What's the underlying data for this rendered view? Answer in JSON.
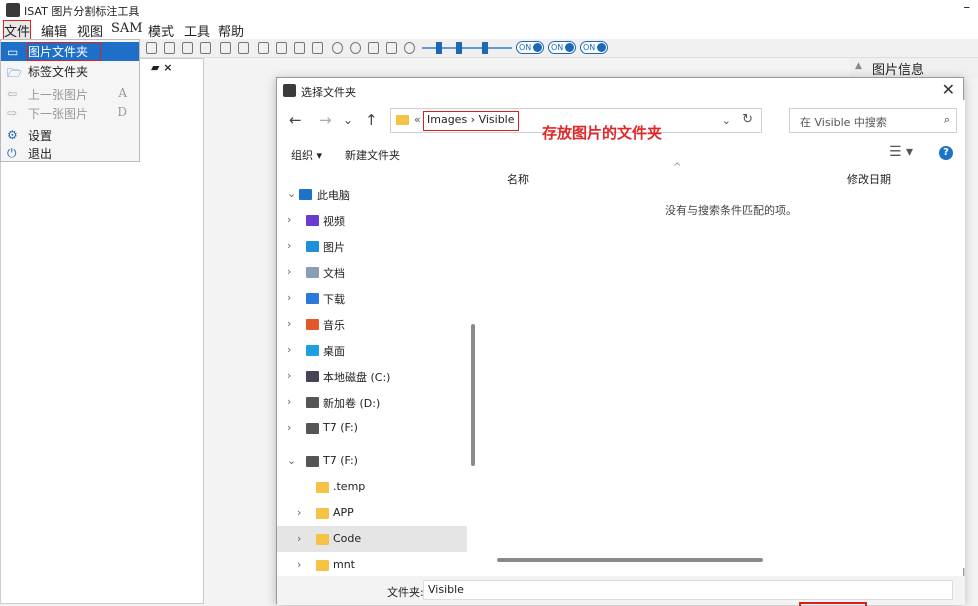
{
  "window": {
    "title": "ISAT 图片分割标注工具",
    "minimize": "–"
  },
  "menubar": [
    "文件",
    "编辑",
    "视图",
    "SAM",
    "模式",
    "工具",
    "帮助"
  ],
  "file_menu": [
    {
      "icon": "▭",
      "label": "图片文件夹",
      "shortcut": ""
    },
    {
      "icon": "🗁",
      "label": "标签文件夹",
      "shortcut": ""
    },
    {
      "icon": "⇦",
      "label": "上一张图片",
      "shortcut": "A"
    },
    {
      "icon": "⇨",
      "label": "下一张图片",
      "shortcut": "D"
    },
    {
      "icon": "⚙",
      "label": "设置",
      "shortcut": ""
    },
    {
      "icon": "⏻",
      "label": "退出",
      "shortcut": ""
    }
  ],
  "toolbar": {
    "toggles": [
      "ON",
      "ON",
      "ON"
    ]
  },
  "left_panel": {
    "header_icons": "▰ ×"
  },
  "right_panel": {
    "title": "图片信息",
    "arrow": "▲"
  },
  "dialog": {
    "title": "选择文件夹",
    "close": "✕",
    "nav": {
      "back": "←",
      "forward": "→",
      "recent": "⌄",
      "up": "↑"
    },
    "address": {
      "sep": "«",
      "path": "Images › Visible",
      "dropdown": "⌄",
      "refresh": "↻"
    },
    "search_placeholder": "在 Visible 中搜索",
    "annotation": "存放图片的文件夹",
    "commands": {
      "organize": "组织 ▾",
      "new_folder": "新建文件夹",
      "view": "☰ ▾",
      "help": "?"
    },
    "tree": [
      {
        "arrow": "⌄",
        "label": "此电脑",
        "color": "#1e73c8"
      },
      {
        "arrow": "›",
        "label": "视频",
        "color": "#6a3bd0"
      },
      {
        "arrow": "›",
        "label": "图片",
        "color": "#1e8fd8"
      },
      {
        "arrow": "›",
        "label": "文档",
        "color": "#8a9db5"
      },
      {
        "arrow": "›",
        "label": "下载",
        "color": "#2a7ad8"
      },
      {
        "arrow": "›",
        "label": "音乐",
        "color": "#e2582a"
      },
      {
        "arrow": "›",
        "label": "桌面",
        "color": "#1ea0e0"
      },
      {
        "arrow": "›",
        "label": "本地磁盘 (C:)",
        "color": "#445"
      },
      {
        "arrow": "›",
        "label": "新加卷 (D:)",
        "color": "#555"
      },
      {
        "arrow": "›",
        "label": "T7 (F:)",
        "color": "#555"
      },
      {
        "arrow": "⌄",
        "label": "T7 (F:)",
        "color": "#555"
      },
      {
        "arrow": "",
        "label": ".temp",
        "color": "#f5c343"
      },
      {
        "arrow": "›",
        "label": "APP",
        "color": "#f5c343"
      },
      {
        "arrow": "›",
        "label": "Code",
        "color": "#f5c343"
      },
      {
        "arrow": "›",
        "label": "mnt",
        "color": "#f5c343"
      }
    ],
    "columns": {
      "name": "名称",
      "date": "修改日期",
      "sort_caret": "^"
    },
    "empty_text": "没有与搜索条件匹配的项。",
    "folder_label": "文件夹:",
    "folder_value": "Visible"
  }
}
